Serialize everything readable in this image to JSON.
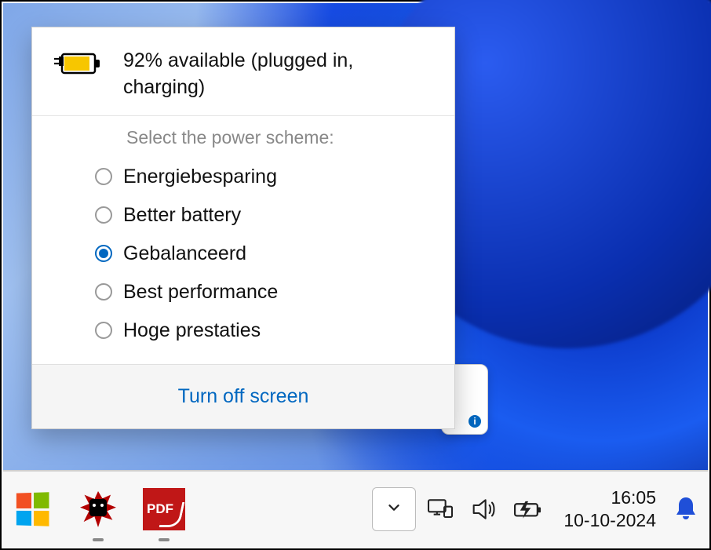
{
  "flyout": {
    "status_text": "92% available (plugged in, charging)",
    "select_label": "Select the power scheme:",
    "schemes": [
      {
        "label": "Energiebesparing",
        "selected": false
      },
      {
        "label": "Better battery",
        "selected": false
      },
      {
        "label": "Gebalanceerd",
        "selected": true
      },
      {
        "label": "Best performance",
        "selected": false
      },
      {
        "label": "Hoge prestaties",
        "selected": false
      }
    ],
    "turn_off_label": "Turn off screen"
  },
  "taskbar": {
    "pdf_label": "PDF",
    "time": "16:05",
    "date": "10-10-2024"
  },
  "tip_info_glyph": "i"
}
